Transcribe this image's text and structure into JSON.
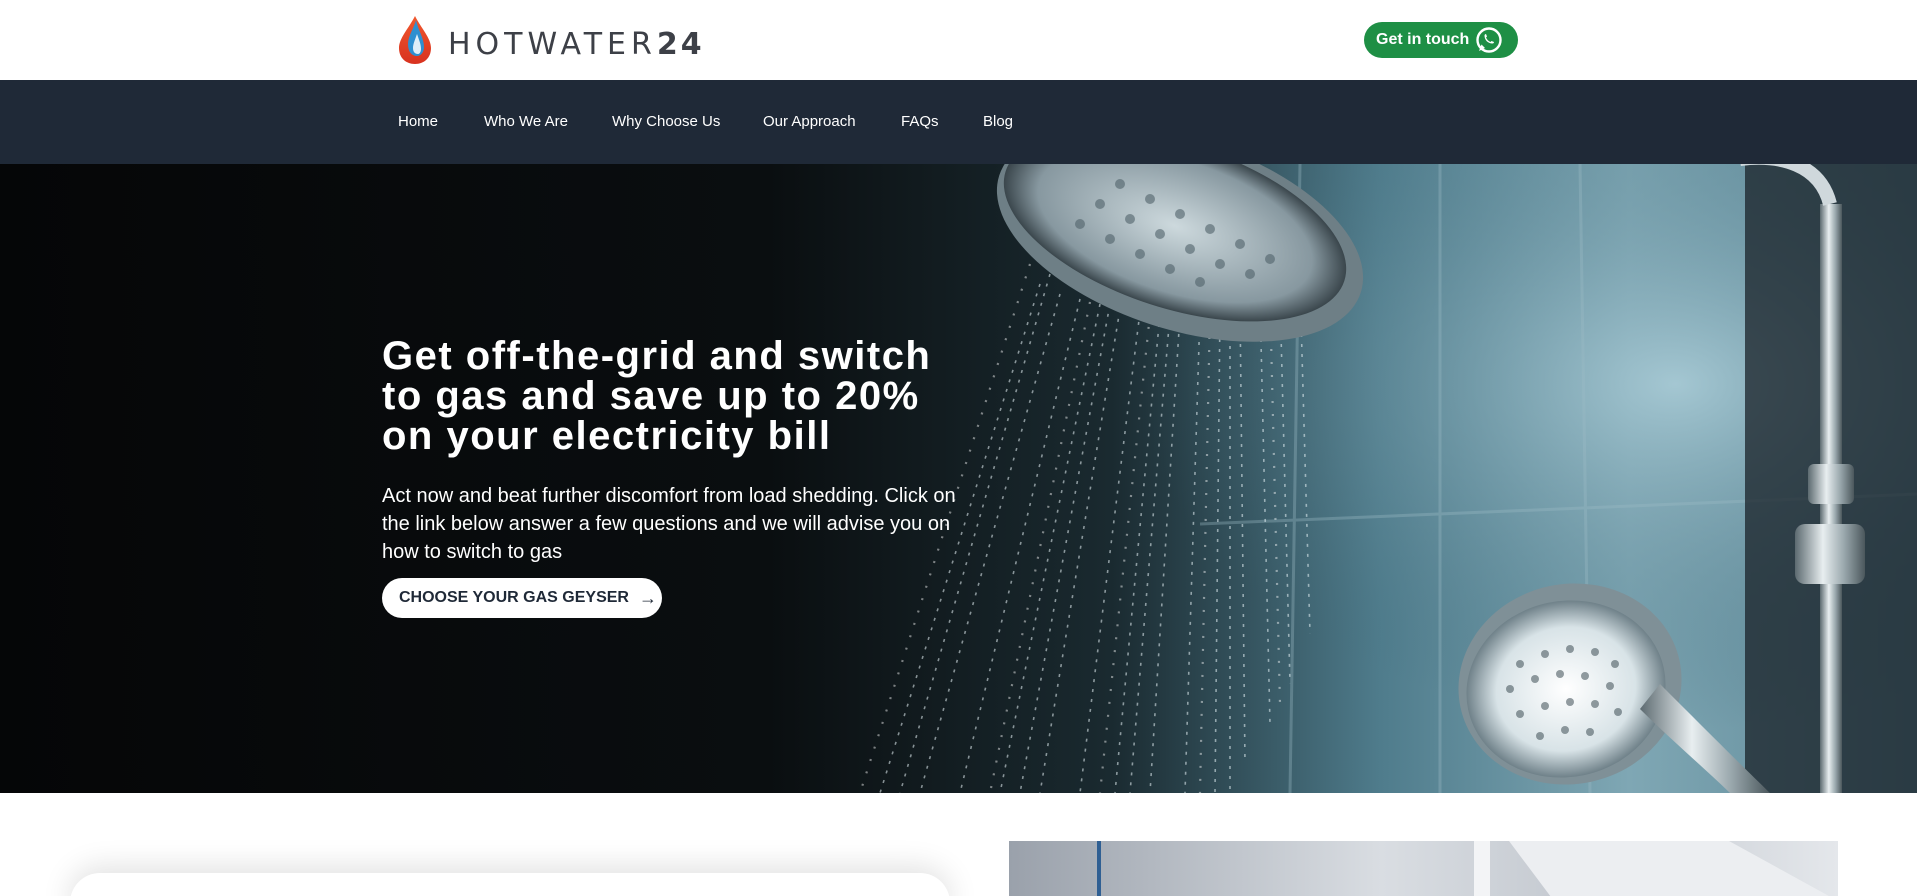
{
  "header": {
    "logo_text": "HOTWATER",
    "logo_number": "24",
    "contact_label": "Get in touch",
    "contact_icon": "whatsapp-icon",
    "contact_color": "#1e8f45"
  },
  "nav": {
    "items": [
      {
        "label": "Home"
      },
      {
        "label": "Who We Are"
      },
      {
        "label": "Why Choose Us"
      },
      {
        "label": "Our Approach"
      },
      {
        "label": "FAQs"
      },
      {
        "label": "Blog"
      }
    ],
    "background": "#1f2937"
  },
  "hero": {
    "title": "Get off-the-grid and switch to gas and save up to 20% on your electricity bill",
    "description": "Act now and beat further discomfort from load shedding. Click on the link below answer a few questions and we will advise you on how to switch to gas",
    "cta_label": "CHOOSE YOUR GAS GEYSER",
    "cta_icon": "arrow-right-icon"
  },
  "logo_colors": {
    "drop_blue": "#2f8fd0",
    "drop_red": "#e0422c"
  }
}
